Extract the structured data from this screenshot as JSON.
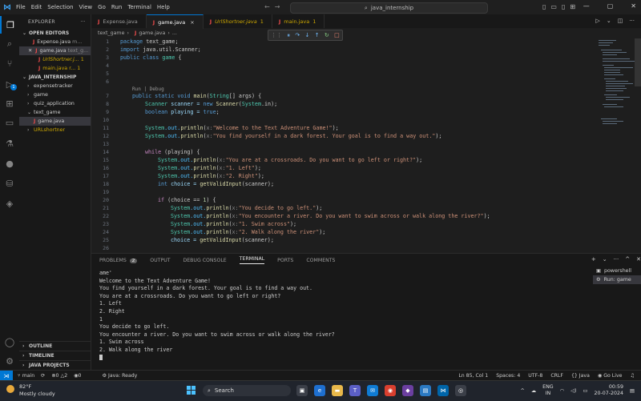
{
  "titlebar": {
    "menu": [
      "File",
      "Edit",
      "Selection",
      "View",
      "Go",
      "Run",
      "Terminal",
      "Help"
    ],
    "search": "java_internship"
  },
  "sidebar": {
    "title": "EXPLORER",
    "open_editors_label": "OPEN EDITORS",
    "open_editors": [
      {
        "name": "Expense.java",
        "path": "m..."
      },
      {
        "name": "game.java",
        "path": "text_g..."
      },
      {
        "name": "UrlShortner.j...",
        "count": "1"
      },
      {
        "name": "main.java",
        "path": "r...",
        "count": "1"
      }
    ],
    "workspace_label": "JAVA_INTERNSHIP",
    "tree": [
      "expensetracker",
      "game",
      "quiz_application",
      "text_game",
      "game.java",
      "URLshortner"
    ],
    "outline": "OUTLINE",
    "timeline": "TIMELINE",
    "java_projects": "JAVA PROJECTS"
  },
  "activity": {
    "badge": "1"
  },
  "tabs": [
    {
      "label": "Expense.java"
    },
    {
      "label": "game.java",
      "close": "×"
    },
    {
      "label": "UrlShortner.java",
      "count": "1"
    },
    {
      "label": "main.java",
      "count": "1"
    }
  ],
  "breadcrumb": {
    "folder": "text_game",
    "file": "game.java",
    "tail": "..."
  },
  "editor": {
    "line_numbers": [
      "1",
      "2",
      "3",
      "4",
      "5",
      "6",
      "7",
      "8",
      "9",
      "10",
      "11",
      "12",
      "13",
      "14",
      "15",
      "16",
      "17",
      "18",
      "19",
      "20",
      "21",
      "22",
      "23",
      "24",
      "25",
      "26"
    ],
    "codelens": "Run | Debug",
    "l1a": "package",
    "l1b": " text_game;",
    "l2a": "import",
    "l2b": " java.util.Scanner;",
    "l3a": "public class",
    "l3b": " game",
    "l3c": " {",
    "l7a": "public static void",
    "l7b": " main",
    "l7c": "(",
    "l7d": "String",
    "l7e": "[] args) {",
    "l8a": "Scanner",
    "l8b": " scanner = ",
    "l8c": "new",
    "l8d": " Scanner",
    "l8e": "(",
    "l8f": "System",
    "l8g": ".in);",
    "l9a": "boolean",
    "l9b": " playing = ",
    "l9c": "true",
    "l9d": ";",
    "sys": "System",
    "out": ".out.",
    "println": "println",
    "xhint": "x:",
    "s11": "\"Welcome to the Text Adventure Game!\"",
    "s12": "\"You find yourself in a dark forest. Your goal is to find a way out.\"",
    "l14a": "while",
    "l14b": " (playing) {",
    "s15": "\"You are at a crossroads. Do you want to go left or right?\"",
    "s16": "\"1. Left\"",
    "s17": "\"2. Right\"",
    "l18a": "int",
    "l18b": " choice = ",
    "l18c": "getValidInput",
    "l18d": "(scanner);",
    "l20a": "if",
    "l20b": " (choice == ",
    "l20c": "1",
    "l20d": ") {",
    "s21": "\"You decide to go left.\"",
    "s22": "\"You encounter a river. Do you want to swim across or walk along the river?\"",
    "s23": "\"1. Swim across\"",
    "s24": "\"2. Walk along the river\"",
    "l25a": "choice = ",
    "l25b": "getValidInput",
    "l25c": "(scanner);",
    "close": ");"
  },
  "panel": {
    "tabs": [
      "PROBLEMS",
      "OUTPUT",
      "DEBUG CONSOLE",
      "TERMINAL",
      "PORTS",
      "COMMENTS"
    ],
    "problems_count": "2",
    "terminal_lines": [
      "ame'",
      "Welcome to the Text Adventure Game!",
      "You find yourself in a dark forest. Your goal is to find a way out.",
      "You are at a crossroads. Do you want to go left or right?",
      "1. Left",
      "2. Right",
      "1",
      "You decide to go left.",
      "You encounter a river. Do you want to swim across or walk along the river?",
      "1. Swim across",
      "2. Walk along the river"
    ],
    "terminals": [
      "powershell",
      "Run: game"
    ]
  },
  "status": {
    "branch": "main",
    "sync": "⟳",
    "errors": "0",
    "warnings": "2",
    "ports": "0",
    "java": "Java: Ready",
    "position": "Ln 85, Col 1",
    "spaces": "Spaces: 4",
    "encoding": "UTF-8",
    "eol": "CRLF",
    "language": "Java",
    "golive": "Go Live"
  },
  "taskbar": {
    "temp": "82°F",
    "weather": "Mostly cloudy",
    "search": "Search",
    "lang1": "ENG",
    "lang2": "IN",
    "time": "00:59",
    "date": "20-07-2024"
  }
}
